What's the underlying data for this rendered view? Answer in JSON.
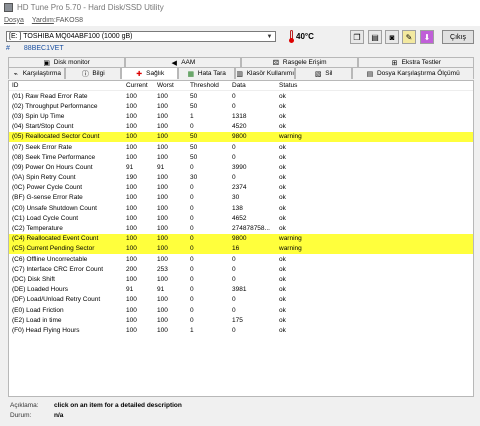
{
  "window": {
    "title": "HD Tune Pro 5.70 - Hard Disk/SSD Utility"
  },
  "menu": {
    "items": [
      "Dosya",
      "Yardım"
    ],
    "extra": "FAKOS8"
  },
  "toolbar": {
    "drive": "[E: ] TOSHIBA MQ04ABF100 (1000 gB)",
    "serial_hash": "#",
    "serial": "88BEC1VET",
    "temperature": "40°C",
    "exit_label": "Çıkış"
  },
  "tabs_row1": [
    {
      "label": "Disk monitor",
      "icon": "disk-monitor-icon"
    },
    {
      "label": "AAM",
      "icon": "speaker-icon"
    },
    {
      "label": "Rasgele Erişim",
      "icon": "random-access-icon"
    },
    {
      "label": "Ekstra Testler",
      "icon": "extra-tests-icon"
    }
  ],
  "tabs_row2": [
    {
      "label": "Karşılaştırma",
      "icon": "benchmark-icon"
    },
    {
      "label": "Bilgi",
      "icon": "info-icon"
    },
    {
      "label": "Sağlık",
      "icon": "health-icon",
      "active": true
    },
    {
      "label": "Hata Tara",
      "icon": "error-scan-icon"
    },
    {
      "label": "Klasör Kullanımı",
      "icon": "folder-usage-icon"
    },
    {
      "label": "Sil",
      "icon": "erase-icon"
    },
    {
      "label": "Dosya Karşılaştırma Ölçümü",
      "icon": "file-benchmark-icon"
    }
  ],
  "table": {
    "headers": [
      "ID",
      "Current",
      "Worst",
      "Threshold",
      "Data",
      "Status"
    ],
    "rows": [
      [
        "(01) Raw Read Error Rate",
        "100",
        "100",
        "50",
        "0",
        "ok",
        false
      ],
      [
        "(02) Throughput Performance",
        "100",
        "100",
        "50",
        "0",
        "ok",
        false
      ],
      [
        "(03) Spin Up Time",
        "100",
        "100",
        "1",
        "1318",
        "ok",
        false
      ],
      [
        "(04) Start/Stop Count",
        "100",
        "100",
        "0",
        "4520",
        "ok",
        false
      ],
      [
        "(05) Reallocated Sector Count",
        "100",
        "100",
        "50",
        "9800",
        "warning",
        true
      ],
      [
        "(07) Seek Error Rate",
        "100",
        "100",
        "50",
        "0",
        "ok",
        false
      ],
      [
        "(08) Seek Time Performance",
        "100",
        "100",
        "50",
        "0",
        "ok",
        false
      ],
      [
        "(09) Power On Hours Count",
        "91",
        "91",
        "0",
        "3990",
        "ok",
        false
      ],
      [
        "(0A) Spin Retry Count",
        "190",
        "100",
        "30",
        "0",
        "ok",
        false
      ],
      [
        "(0C) Power Cycle Count",
        "100",
        "100",
        "0",
        "2374",
        "ok",
        false
      ],
      [
        "(BF) G-sense Error Rate",
        "100",
        "100",
        "0",
        "30",
        "ok",
        false
      ],
      [
        "(C0) Unsafe Shutdown Count",
        "100",
        "100",
        "0",
        "138",
        "ok",
        false
      ],
      [
        "(C1) Load Cycle Count",
        "100",
        "100",
        "0",
        "4652",
        "ok",
        false
      ],
      [
        "(C2) Temperature",
        "100",
        "100",
        "0",
        "274878758...",
        "ok",
        false
      ],
      [
        "(C4) Reallocated Event Count",
        "100",
        "100",
        "0",
        "9800",
        "warning",
        true
      ],
      [
        "(C5) Current Pending Sector",
        "100",
        "100",
        "0",
        "16",
        "warning",
        true
      ],
      [
        "(C6) Offline Uncorrectable",
        "100",
        "100",
        "0",
        "0",
        "ok",
        false
      ],
      [
        "(C7) Interface CRC Error Count",
        "200",
        "253",
        "0",
        "0",
        "ok",
        false
      ],
      [
        "(DC) Disk Shift",
        "100",
        "100",
        "0",
        "0",
        "ok",
        false
      ],
      [
        "(DE) Loaded Hours",
        "91",
        "91",
        "0",
        "3981",
        "ok",
        false
      ],
      [
        "(DF) Load/Unload Retry Count",
        "100",
        "100",
        "0",
        "0",
        "ok",
        false
      ],
      [
        "(E0) Load Friction",
        "100",
        "100",
        "0",
        "0",
        "ok",
        false
      ],
      [
        "(E2) Load in time",
        "100",
        "100",
        "0",
        "175",
        "ok",
        false
      ],
      [
        "(F0) Head Flying Hours",
        "100",
        "100",
        "1",
        "0",
        "ok",
        false
      ]
    ]
  },
  "status": {
    "desc_label": "Açıklama:",
    "desc_value": "click on an item for a detailed description",
    "state_label": "Durum:",
    "state_value": "n/a"
  },
  "colors": {
    "warning_row": "#ffff3c",
    "serial_text": "#1a4fa0"
  }
}
